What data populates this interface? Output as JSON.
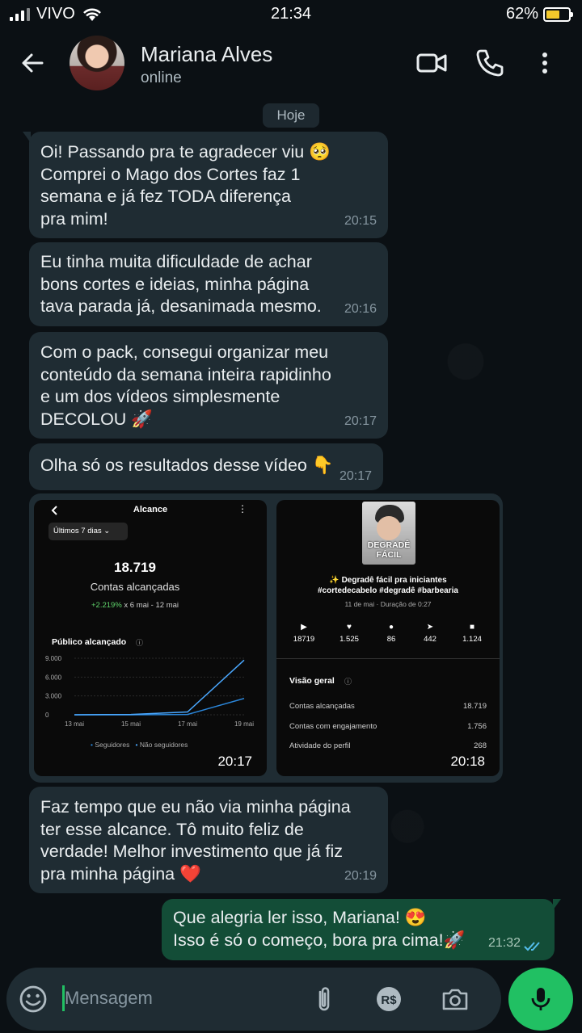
{
  "status_bar": {
    "carrier": "VIVO",
    "time": "21:34",
    "battery": "62%",
    "battery_level": 0.62
  },
  "header": {
    "name": "Mariana Alves",
    "status": "online",
    "icons": [
      "back-arrow-icon",
      "video-call-icon",
      "phone-icon",
      "more-vert-icon"
    ]
  },
  "chat": {
    "date": "Hoje",
    "messages": [
      {
        "text": "Oi! Passando pra te agradecer viu 🥺\nComprei o Mago dos Cortes faz 1\nsemana e já fez TODA diferença\npra mim!",
        "time": "20:15"
      },
      {
        "text": "Eu tinha muita dificuldade de achar\nbons cortes e ideias, minha página\ntava parada já, desanimada mesmo.",
        "time": "20:16"
      },
      {
        "text": "Com o pack, consegui organizar meu\nconteúdo da semana inteira rapidinho\ne um dos vídeos simplesmente\nDECOLOU 🚀",
        "time": "20:17"
      },
      {
        "text": "Olha só os resultados desse vídeo 👇",
        "time": "20:17"
      },
      {
        "text": "Faz tempo que eu não via minha página\nter esse alcance. Tô muito feliz de\nverdade! Melhor investimento que já fiz\npra minha página ❤️",
        "time": "20:19"
      }
    ],
    "outgoing": {
      "text": "Que alegria ler isso, Mariana! 😍\nIsso é só o começo, bora pra cima!🚀",
      "time": "21:32"
    }
  },
  "image1": {
    "time": "20:17",
    "title": "Alcance",
    "period": "Últimos 7 dias",
    "reach": "18.719",
    "reach_label": "Contas alcançadas",
    "growth": "+2.219%",
    "growth_range": "x 6 mai - 12 mai",
    "section": "Público alcançado",
    "legend": [
      "Seguidores",
      "Não seguidores"
    ],
    "chart_data": {
      "type": "line",
      "x": [
        "13 mai",
        "15 mai",
        "17 mai",
        "19 mai"
      ],
      "y_ticks": [
        "9.000",
        "6.000",
        "3.000",
        "0"
      ],
      "ylim": [
        0,
        9000
      ],
      "series": [
        {
          "name": "Seguidores",
          "values": [
            0,
            0,
            50,
            2600
          ]
        },
        {
          "name": "Não seguidores",
          "values": [
            0,
            50,
            450,
            8700
          ]
        }
      ]
    }
  },
  "image2": {
    "time": "20:18",
    "thumb_label_1": "DEGRADÊ",
    "thumb_label_2": "FÁCIL",
    "caption_1": "✨ Degradê fácil pra iniciantes",
    "caption_2": "#cortedecabelo #degradê #barbearia",
    "meta": "11 de mai · Duração de 0:27",
    "stats": [
      "18719",
      "1.525",
      "86",
      "442",
      "1.124"
    ],
    "overview": "Visão geral",
    "rows": [
      {
        "label": "Contas alcançadas",
        "value": "18.719"
      },
      {
        "label": "Contas com engajamento",
        "value": "1.756"
      },
      {
        "label": "Atividade do perfil",
        "value": "268"
      }
    ]
  },
  "composer": {
    "placeholder": "Mensagem"
  },
  "colors": {
    "accent": "#21c063",
    "incoming": "#1f2c33",
    "outgoing": "#134d37",
    "background": "#0b1014"
  }
}
